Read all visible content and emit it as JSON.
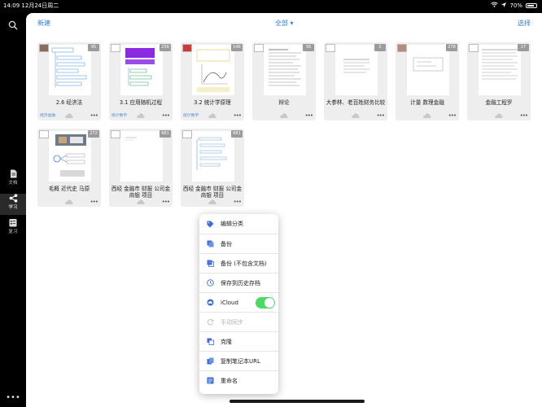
{
  "status": {
    "time": "14:09",
    "date": "12月24日周二",
    "battery": "70%"
  },
  "rail": {
    "items": [
      {
        "label": "文档",
        "icon": "document-icon",
        "active": false
      },
      {
        "label": "学习",
        "icon": "share-icon",
        "active": true
      },
      {
        "label": "复习",
        "icon": "review-icon",
        "active": false
      }
    ],
    "more": "•••"
  },
  "topbar": {
    "new": "新建",
    "filter": "全部 ▾",
    "select": "选择"
  },
  "notebooks": [
    {
      "title": "2.6 经济法",
      "count": "95",
      "tag": "经济金融"
    },
    {
      "title": "3.1 应用随机过程",
      "count": "236",
      "tag": "统计数学"
    },
    {
      "title": "3.2 统计学原理",
      "count": "146",
      "tag": "统计数学"
    },
    {
      "title": "辩论",
      "count": "56",
      "tag": ""
    },
    {
      "title": "大参林、老百姓财务比较",
      "count": "2",
      "tag": ""
    },
    {
      "title": "计量 数理金融",
      "count": "278",
      "tag": ""
    },
    {
      "title": "金融工程罗",
      "count": "17",
      "tag": ""
    },
    {
      "title": "毛概 近代史 马原",
      "count": "272",
      "tag": ""
    },
    {
      "title": "西经 金融市 财报 公司金 商银 项目",
      "count": "681",
      "tag": ""
    },
    {
      "title": "西经 金融市 财报 公司金 商银 项目",
      "count": "681",
      "tag": ""
    }
  ],
  "menu": [
    {
      "label": "编辑分类",
      "icon": "tag-icon",
      "muted": false
    },
    {
      "label": "备份",
      "icon": "backup-icon",
      "muted": false
    },
    {
      "label": "备份 (不包含文档)",
      "icon": "backup-nodoc-icon",
      "muted": false
    },
    {
      "label": "保存到历史存档",
      "icon": "history-icon",
      "muted": false
    },
    {
      "label": "iCloud",
      "icon": "icloud-icon",
      "muted": false
    },
    {
      "label": "手动同步",
      "icon": "sync-icon",
      "muted": true
    },
    {
      "label": "克隆",
      "icon": "clone-icon",
      "muted": false
    },
    {
      "label": "复制笔记本URL",
      "icon": "copy-url-icon",
      "muted": false
    },
    {
      "label": "重命名",
      "icon": "rename-icon",
      "muted": false
    }
  ],
  "icloud_enabled": true,
  "colors": {
    "accent": "#2f7fd8",
    "toggle_on": "#4cd964"
  }
}
